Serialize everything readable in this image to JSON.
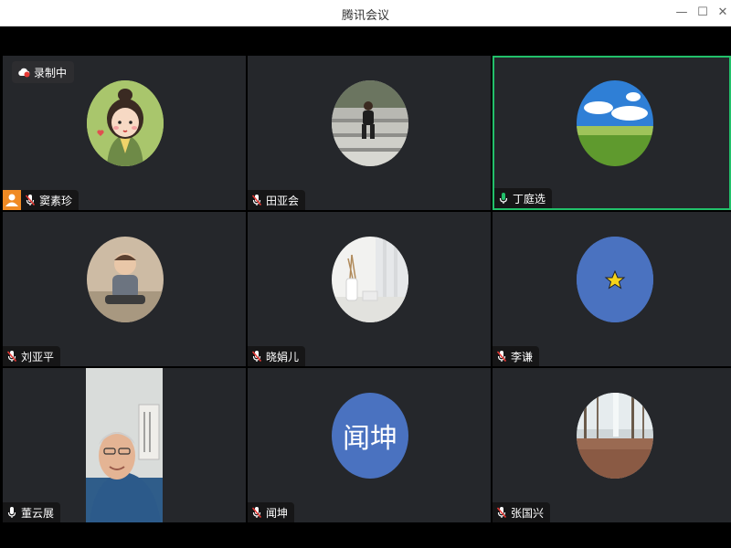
{
  "window": {
    "title": "腾讯会议"
  },
  "recording": {
    "label": "录制中"
  },
  "participants": [
    {
      "name": "窦素珍",
      "mic": "muted",
      "host": true,
      "avatar": "cartoon-girl-avatar"
    },
    {
      "name": "田亚会",
      "mic": "muted",
      "avatar": "child-on-stairs-photo"
    },
    {
      "name": "丁庭选",
      "mic": "active",
      "speaking": true,
      "avatar": "sky-grassland-photo"
    },
    {
      "name": "刘亚平",
      "mic": "muted",
      "avatar": "toddler-photo"
    },
    {
      "name": "晓娟儿",
      "mic": "muted",
      "avatar": "vase-curtain-photo"
    },
    {
      "name": "李谦",
      "mic": "muted",
      "avatar": "yellow-star-avatar"
    },
    {
      "name": "董云展",
      "mic": "on",
      "video": true,
      "avatar": "video-feed"
    },
    {
      "name": "闻坤",
      "mic": "muted",
      "avatar_text": "闻坤"
    },
    {
      "name": "张国兴",
      "mic": "muted",
      "avatar": "forest-photo"
    }
  ],
  "colors": {
    "speaking_border": "#22c06a",
    "host_badge": "#f08a24",
    "tile_bg": "#25272b",
    "text_avatar_bg": "#4a72c0"
  }
}
